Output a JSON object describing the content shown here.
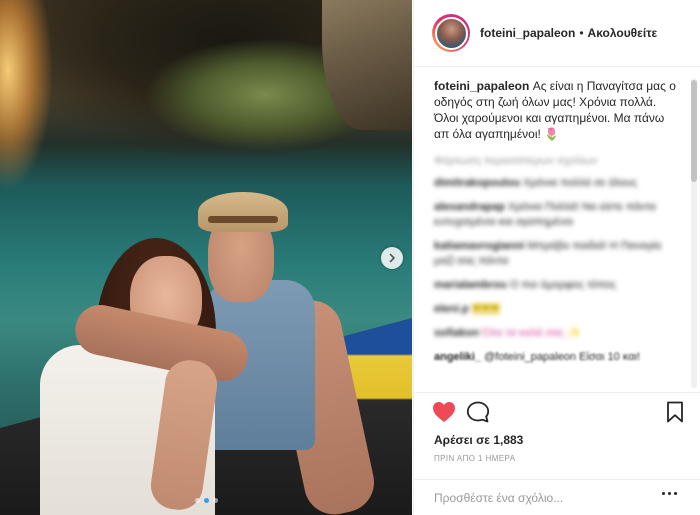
{
  "header": {
    "username": "foteini_papaleon",
    "separator": "•",
    "follow_status": "Ακολουθείτε"
  },
  "caption": {
    "username": "foteini_papaleon",
    "text": "Ας είναι η Παναγίτσα μας ο οδηγός στη ζωή όλων μας! Χρόνια πολλά. Όλοι χαρούμενοι και αγαπημένοι. Μα πάνω απ όλα αγαπημένοι!",
    "emoji": "🌷"
  },
  "comments": {
    "load_more": "Φόρτωση περισσότερων σχολίων",
    "items": [
      {
        "user": "dimitrakopoulou",
        "text": "Χρόνια πολλά σε όλους"
      },
      {
        "user": "alexandrapap",
        "text": "Χρόνια Πολλά! Να είστε πάντα ευτυχισμένοι και αγαπημένοι"
      },
      {
        "user": "katiamavrogianni",
        "text": "Μπράβο παιδιά! Η Παναγία μαζί σας πάντα"
      },
      {
        "user": "marialambrou",
        "text": "Ο πιο όμορφος τόπος"
      },
      {
        "user": "eleni.p",
        "text": "❤❤❤"
      },
      {
        "user": "sofiakon",
        "text": "Όλα τα καλά σας ✨"
      },
      {
        "user": "angeliki_",
        "text": "@foteini_papaleon Είσαι 10 και!"
      }
    ]
  },
  "actions": {
    "like_icon": "heart-filled-icon",
    "comment_icon": "comment-bubble-icon",
    "save_icon": "bookmark-icon",
    "likes_text": "Αρέσει σε 1,883",
    "time_text": "ΠΡΙΝ ΑΠΟ 1 ΗΜΕΡΑ",
    "comment_placeholder": "Προσθέστε ένα σχόλιο...",
    "more_icon": "more-options-icon"
  },
  "carousel": {
    "next_icon": "chevron-right-icon",
    "slide_count": 3,
    "active_index": 1
  },
  "colors": {
    "like": "#ed4956",
    "active_dot": "#3897f0",
    "text": "#262626",
    "muted": "#999999"
  }
}
